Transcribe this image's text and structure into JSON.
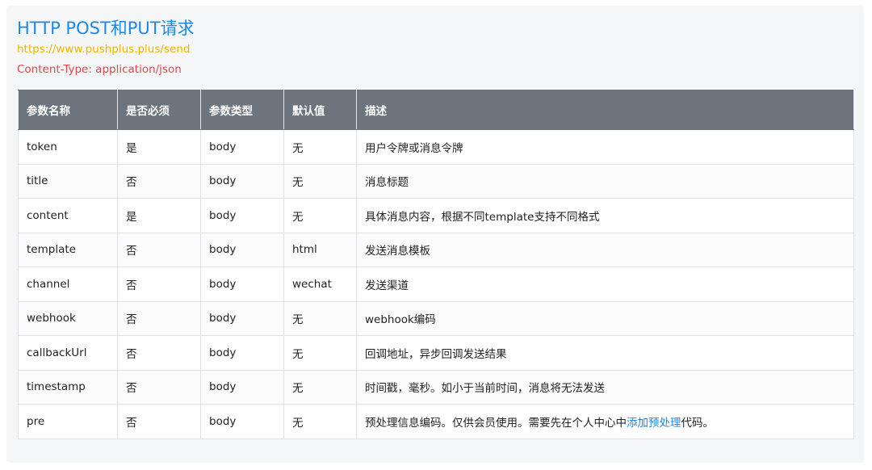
{
  "header": {
    "title": "HTTP POST和PUT请求",
    "url": "https://www.pushplus.plus/send",
    "content_type": "Content-Type: application/json"
  },
  "table": {
    "columns": [
      "参数名称",
      "是否必须",
      "参数类型",
      "默认值",
      "描述"
    ],
    "rows": [
      {
        "name": "token",
        "required": "是",
        "type": "body",
        "default": "无",
        "desc": "用户令牌或消息令牌"
      },
      {
        "name": "title",
        "required": "否",
        "type": "body",
        "default": "无",
        "desc": "消息标题"
      },
      {
        "name": "content",
        "required": "是",
        "type": "body",
        "default": "无",
        "desc": "具体消息内容，根据不同template支持不同格式"
      },
      {
        "name": "template",
        "required": "否",
        "type": "body",
        "default": "html",
        "desc": "发送消息模板"
      },
      {
        "name": "channel",
        "required": "否",
        "type": "body",
        "default": "wechat",
        "desc": "发送渠道"
      },
      {
        "name": "webhook",
        "required": "否",
        "type": "body",
        "default": "无",
        "desc": "webhook编码"
      },
      {
        "name": "callbackUrl",
        "required": "否",
        "type": "body",
        "default": "无",
        "desc": "回调地址，异步回调发送结果"
      },
      {
        "name": "timestamp",
        "required": "否",
        "type": "body",
        "default": "无",
        "desc": "时间戳，毫秒。如小于当前时间，消息将无法发送"
      },
      {
        "name": "pre",
        "required": "否",
        "type": "body",
        "default": "无",
        "desc": "预处理信息编码。仅供会员使用。需要先在个人中心中",
        "desc_link": "添加预处理",
        "desc_suffix": "代码。"
      }
    ]
  }
}
